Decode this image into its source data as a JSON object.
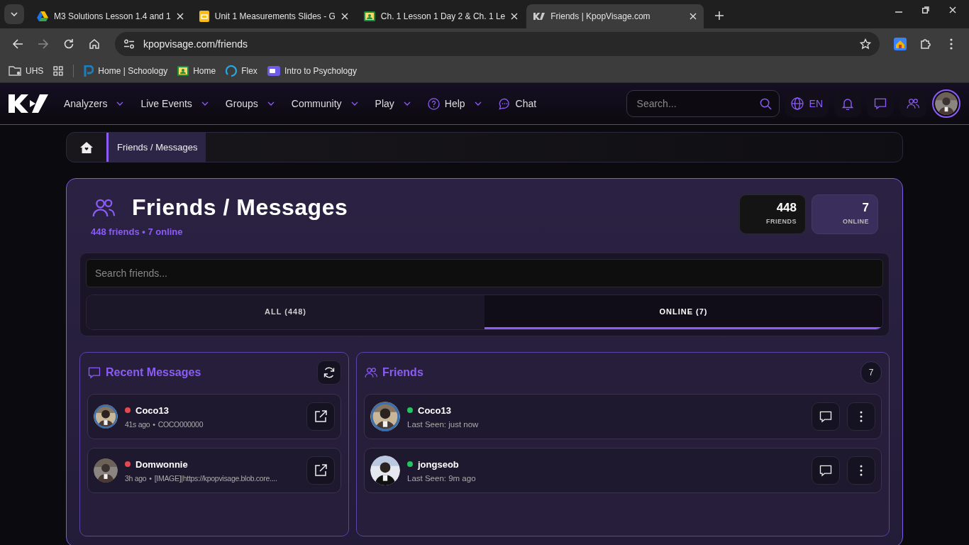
{
  "browser": {
    "tabs": [
      {
        "title": "M3 Solutions Lesson 1.4 and 1",
        "kind": "drive",
        "selected": false
      },
      {
        "title": "Unit 1 Measurements Slides - G",
        "kind": "slides",
        "selected": false
      },
      {
        "title": "Ch. 1 Lesson 1 Day 2 & Ch. 1 Le",
        "kind": "classroom",
        "selected": false
      },
      {
        "title": "Friends | KpopVisage.com",
        "kind": "site",
        "selected": true
      }
    ],
    "address": "kpopvisage.com/friends",
    "bookmarks": [
      {
        "label": "UHS",
        "kind": "folder"
      },
      {
        "label": "Home | Schoology",
        "kind": "schoology"
      },
      {
        "label": "Home",
        "kind": "classroom"
      },
      {
        "label": "Flex",
        "kind": "flex"
      },
      {
        "label": "Intro to Psychology",
        "kind": "media"
      }
    ]
  },
  "site": {
    "nav": [
      {
        "label": "Analyzers",
        "kind": "plain",
        "dropdown": true
      },
      {
        "label": "Live Events",
        "kind": "plain",
        "dropdown": true
      },
      {
        "label": "Groups",
        "kind": "plain",
        "dropdown": true
      },
      {
        "label": "Community",
        "kind": "plain",
        "dropdown": true
      },
      {
        "label": "Play",
        "kind": "plain",
        "dropdown": true
      },
      {
        "label": "Help",
        "kind": "help",
        "dropdown": true
      },
      {
        "label": "Chat",
        "kind": "chat",
        "dropdown": false
      }
    ],
    "search": {
      "placeholder": "Search..."
    },
    "language": "EN"
  },
  "breadcrumb": {
    "current": "Friends / Messages"
  },
  "header": {
    "title": "Friends / Messages",
    "summary": "448 friends • 7 online",
    "stats": [
      {
        "value": "448",
        "label": "FRIENDS",
        "kind": "dark"
      },
      {
        "value": "7",
        "label": "ONLINE",
        "kind": "tinted"
      }
    ]
  },
  "search": {
    "placeholder": "Search friends..."
  },
  "filter_tabs": [
    {
      "label": "ALL (448)",
      "selected": false
    },
    {
      "label": "ONLINE (7)",
      "selected": true
    }
  ],
  "recent_messages": {
    "title": "Recent Messages",
    "items": [
      {
        "name": "Coco13",
        "color": "#e5484d",
        "time": "41s ago",
        "separator": "•",
        "preview": "COCO000000"
      },
      {
        "name": "Domwonnie",
        "color": "#e5484d",
        "time": "3h ago",
        "separator": "•",
        "preview": "[IMAGE]|https://kpopvisage.blob.core...."
      }
    ]
  },
  "friends": {
    "title": "Friends",
    "count": "7",
    "items": [
      {
        "name": "Coco13",
        "color": "#22c55e",
        "last_seen": "Last Seen: just now"
      },
      {
        "name": "jongseob",
        "color": "#22c55e",
        "last_seen": "Last Seen: 9m ago"
      }
    ]
  }
}
